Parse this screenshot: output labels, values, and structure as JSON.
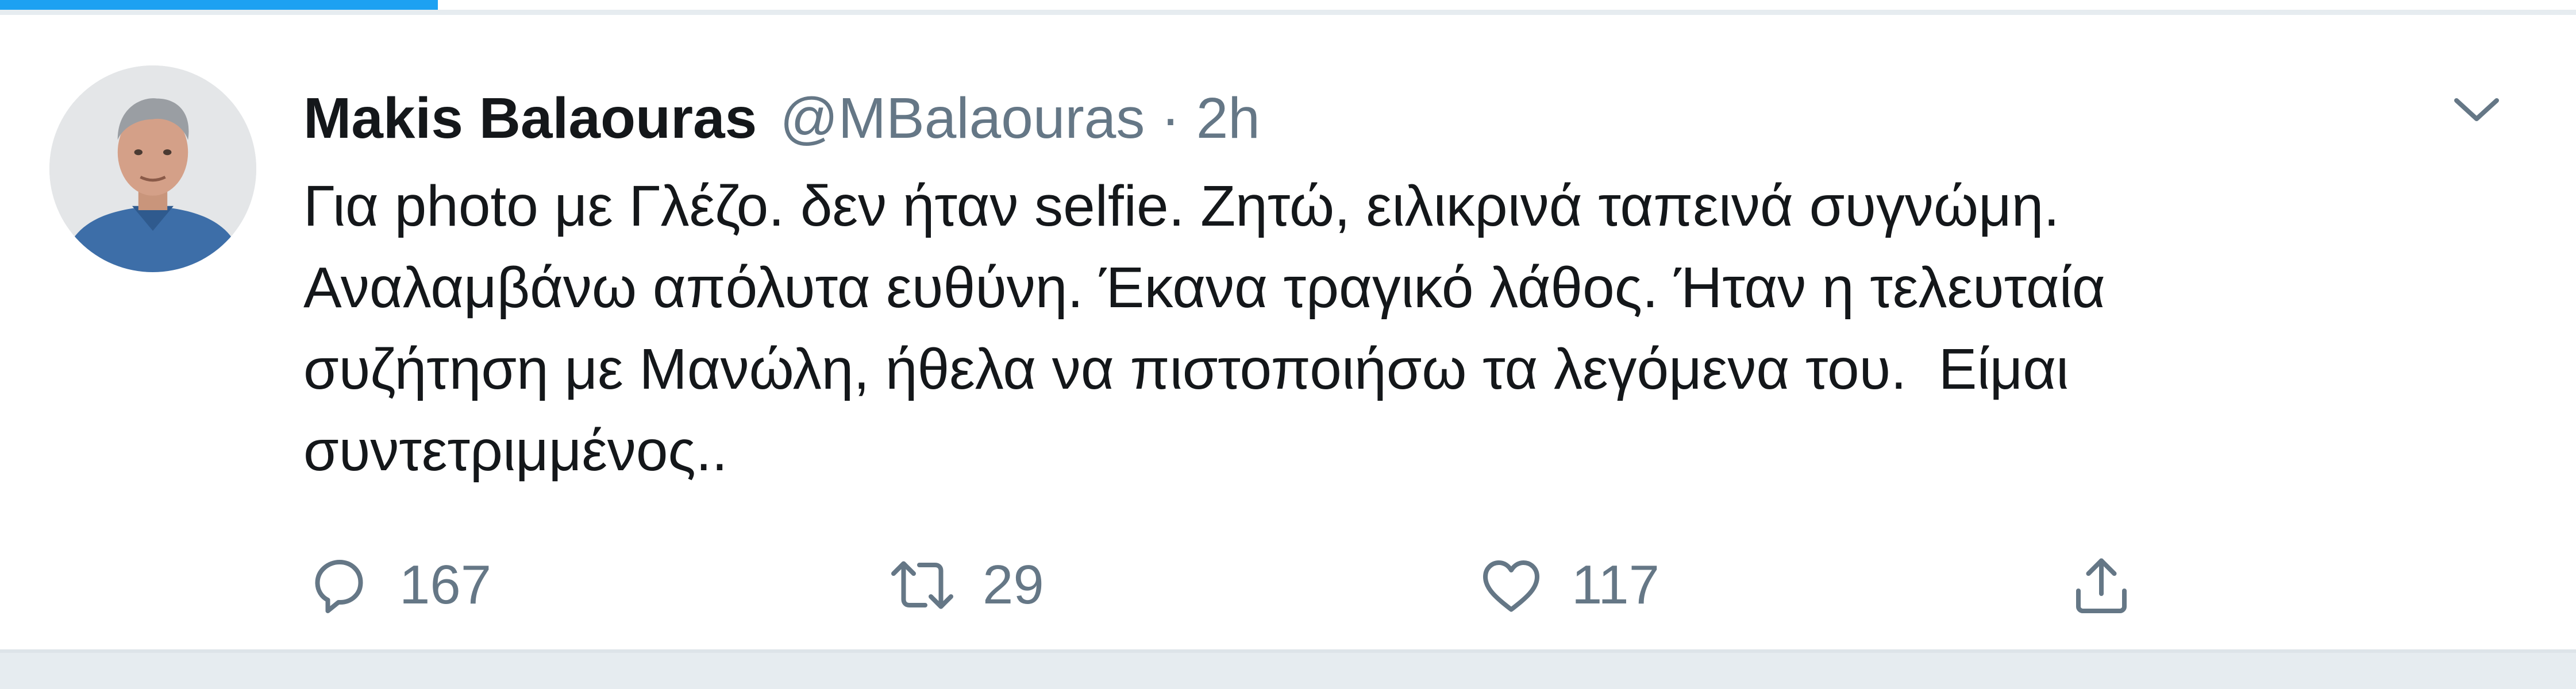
{
  "page_load_progress": 0.17,
  "tweet": {
    "author": {
      "display_name": "Makis Balaouras",
      "handle": "@MBalaouras",
      "separator": "·",
      "time": "2h"
    },
    "text": "Για photo με Γλέζο. δεν ήταν selfie. Ζητώ, ειλικρινά ταπεινά συγνώμη.\nΑναλαμβάνω απόλυτα ευθύνη. Έκανα τραγικό λάθος. Ήταν η τελευταία\nσυζήτηση με Μανώλη, ήθελα να πιστοποιήσω τα λεγόμενα του.  Είμαι\nσυντετριμμένος..",
    "actions": {
      "reply": {
        "icon": "reply-icon",
        "count": "167"
      },
      "retweet": {
        "icon": "retweet-icon",
        "count": "29"
      },
      "like": {
        "icon": "heart-icon",
        "count": "117"
      },
      "share": {
        "icon": "share-icon"
      }
    },
    "menu_icon": "chevron-down-icon"
  },
  "colors": {
    "accent": "#1da1f2",
    "text_primary": "#14171a",
    "text_secondary": "#657786",
    "divider": "#e6ecf0"
  }
}
